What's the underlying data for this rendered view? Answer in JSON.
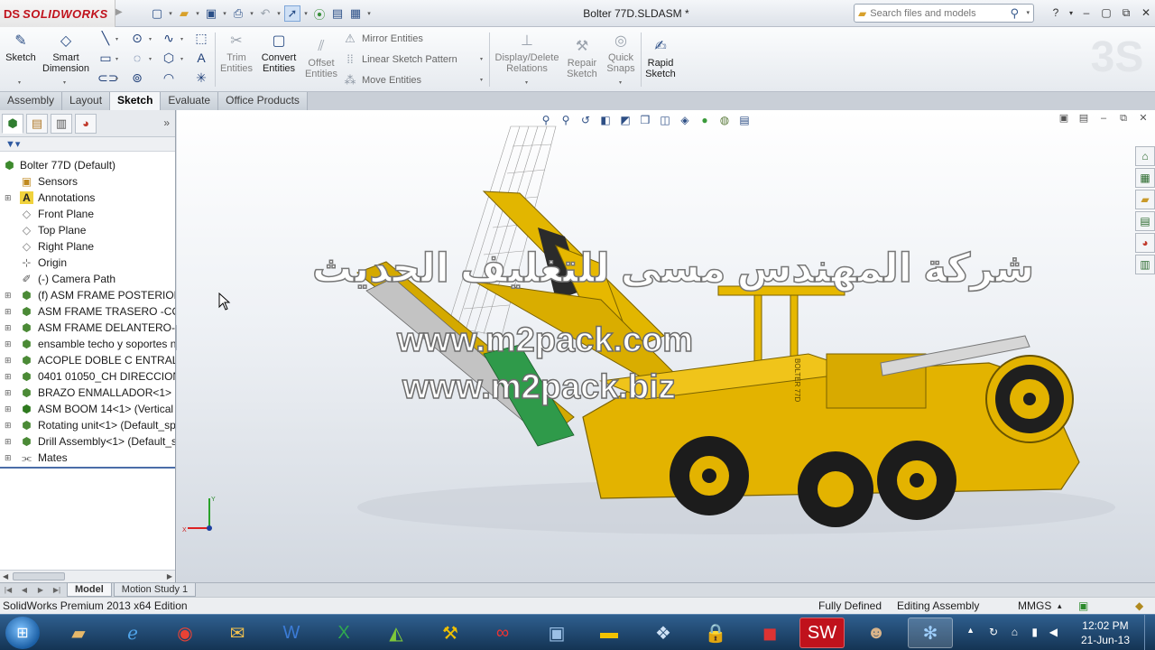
{
  "app": {
    "brand": "SOLIDWORKS",
    "doc_title": "Bolter 77D.SLDASM *"
  },
  "search": {
    "placeholder": "Search files and models"
  },
  "command_manager": {
    "sketch": "Sketch",
    "smart_dimension_1": "Smart",
    "smart_dimension_2": "Dimension",
    "trim_1": "Trim",
    "trim_2": "Entities",
    "convert_1": "Convert",
    "convert_2": "Entities",
    "offset_1": "Offset",
    "offset_2": "Entities",
    "mirror": "Mirror Entities",
    "linear_pattern": "Linear Sketch Pattern",
    "move": "Move Entities",
    "display_delete_1": "Display/Delete",
    "display_delete_2": "Relations",
    "repair_1": "Repair",
    "repair_2": "Sketch",
    "quick_snaps_1": "Quick",
    "quick_snaps_2": "Snaps",
    "rapid_1": "Rapid",
    "rapid_2": "Sketch"
  },
  "tabs": [
    "Assembly",
    "Layout",
    "Sketch",
    "Evaluate",
    "Office Products"
  ],
  "active_tab": "Sketch",
  "tree": {
    "root": "Bolter 77D  (Default)",
    "items": [
      "Sensors",
      "Annotations",
      "Front Plane",
      "Top Plane",
      "Right Plane",
      "Origin",
      "(-) Camera Path",
      "(f) ASM FRAME POSTERIOR-",
      "ASM FRAME TRASERO -COM",
      "ASM FRAME DELANTERO-C(",
      "ensamble techo y soportes n",
      "ACOPLE DOBLE C ENTRAL<1",
      "0401 01050_CH DIRECCION (",
      "BRAZO ENMALLADOR<1> (r",
      "ASM BOOM 14<1> (Vertical",
      "Rotating unit<1> (Default_sp",
      "Drill Assembly<1> (Default_s",
      "Mates"
    ]
  },
  "graphics": {
    "watermark_arabic": "شركة المهندس مسى للتغليف الحديث",
    "watermark_url_1": "www.m2pack.com",
    "watermark_url_2": "www.m2pack.biz",
    "machine_label": "BOLTER 77D"
  },
  "model_tabs": [
    "Model",
    "Motion Study 1"
  ],
  "status": {
    "edition": "SolidWorks Premium 2013 x64 Edition",
    "defined": "Fully Defined",
    "editing": "Editing Assembly",
    "units": "MMGS"
  },
  "taskbar": {
    "time": "12:02 PM",
    "date": "21-Jun-13"
  },
  "colors": {
    "brand_red": "#c0121c",
    "machine_yellow": "#e6b800",
    "taskbar_blue": "#1f4a74"
  }
}
